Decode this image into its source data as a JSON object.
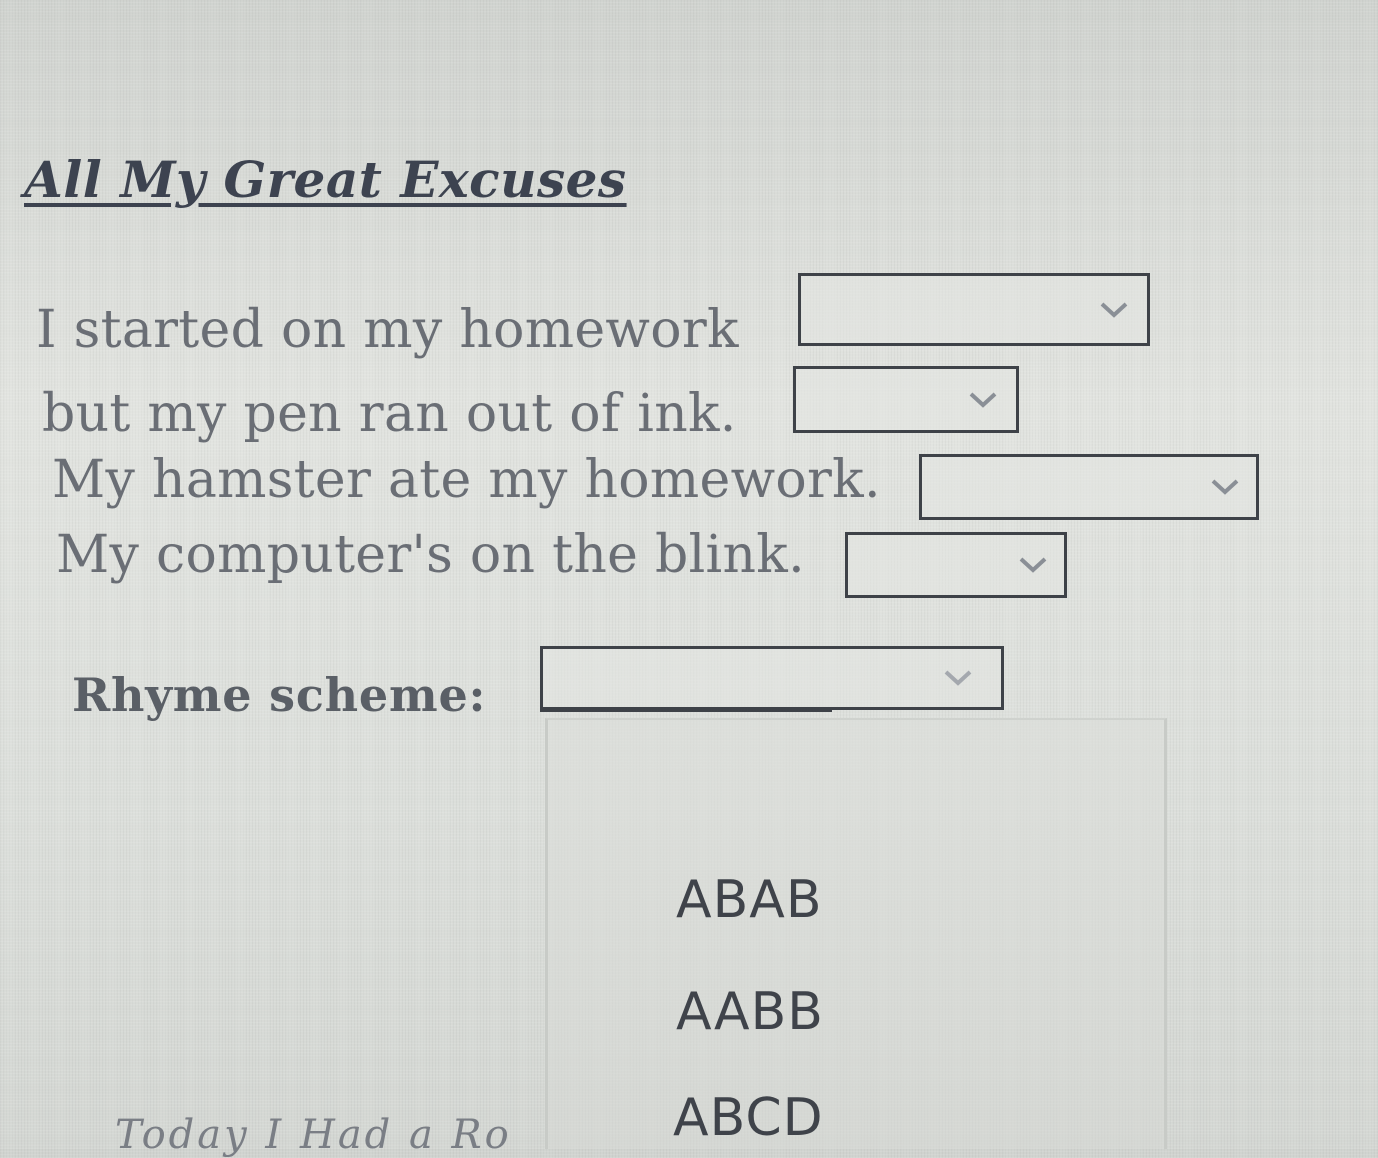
{
  "title": "All My Great Excuses",
  "poem": {
    "lines": [
      "I started on my homework",
      "but my pen ran out of ink.",
      "My hamster ate my homework.",
      "My computer's on the blink."
    ],
    "dropdown_values": [
      "",
      "",
      "",
      ""
    ]
  },
  "rhyme_scheme": {
    "label": "Rhyme scheme:",
    "value": "",
    "options": [
      "ABAB",
      "AABB",
      "ABCD"
    ]
  },
  "footer_title": "Today I Had a Ro",
  "icons": {
    "dropdown": "chevron-down-icon"
  },
  "colors": {
    "background": "#d9dcd8",
    "border": "#3e4248",
    "text": "#6a6e75",
    "title": "#3d4350"
  }
}
